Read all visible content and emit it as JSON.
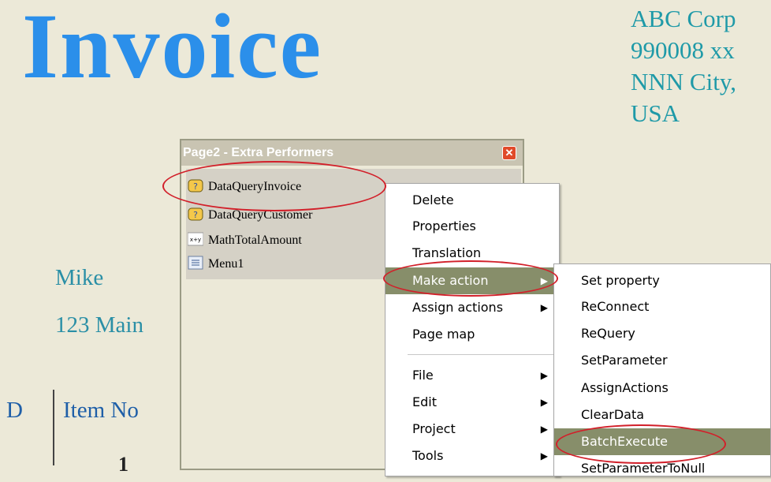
{
  "document": {
    "title": "Invoice",
    "company_lines": [
      "ABC Corp",
      "990008 xx",
      "NNN City,",
      "USA"
    ],
    "customer_name": "Mike",
    "customer_address": "123 Main",
    "column_headers": [
      "D",
      "Item No"
    ],
    "first_row_value": "1"
  },
  "panel": {
    "title": "Page2 - Extra Performers",
    "close_label": "✕",
    "items": [
      {
        "label": "DataQueryInvoice",
        "icon": "dataquery-icon"
      },
      {
        "label": "DataQueryCustomer",
        "icon": "dataquery-icon"
      },
      {
        "label": "MathTotalAmount",
        "icon": "math-icon"
      },
      {
        "label": "Menu1",
        "icon": "menu-icon"
      }
    ]
  },
  "context_menu": {
    "items": [
      {
        "label": "Delete"
      },
      {
        "label": "Properties"
      },
      {
        "label": "Translation"
      },
      {
        "label": "Make action",
        "highlighted": true,
        "submenu": true
      },
      {
        "label": "Assign actions",
        "submenu": true
      },
      {
        "label": "Page map"
      },
      {
        "label": "File",
        "submenu": true
      },
      {
        "label": "Edit",
        "submenu": true
      },
      {
        "label": "Project",
        "submenu": true
      },
      {
        "label": "Tools",
        "submenu": true
      }
    ]
  },
  "submenu": {
    "items": [
      {
        "label": "Set property"
      },
      {
        "label": "ReConnect"
      },
      {
        "label": "ReQuery"
      },
      {
        "label": "SetParameter"
      },
      {
        "label": "AssignActions"
      },
      {
        "label": "ClearData"
      },
      {
        "label": "BatchExecute",
        "highlighted": true
      },
      {
        "label": "SetParameterToNull"
      }
    ]
  },
  "colors": {
    "title": "#2b8fea",
    "company_text": "#1f9aa8",
    "highlight": "#878e6a",
    "annotation": "#d2202a"
  }
}
